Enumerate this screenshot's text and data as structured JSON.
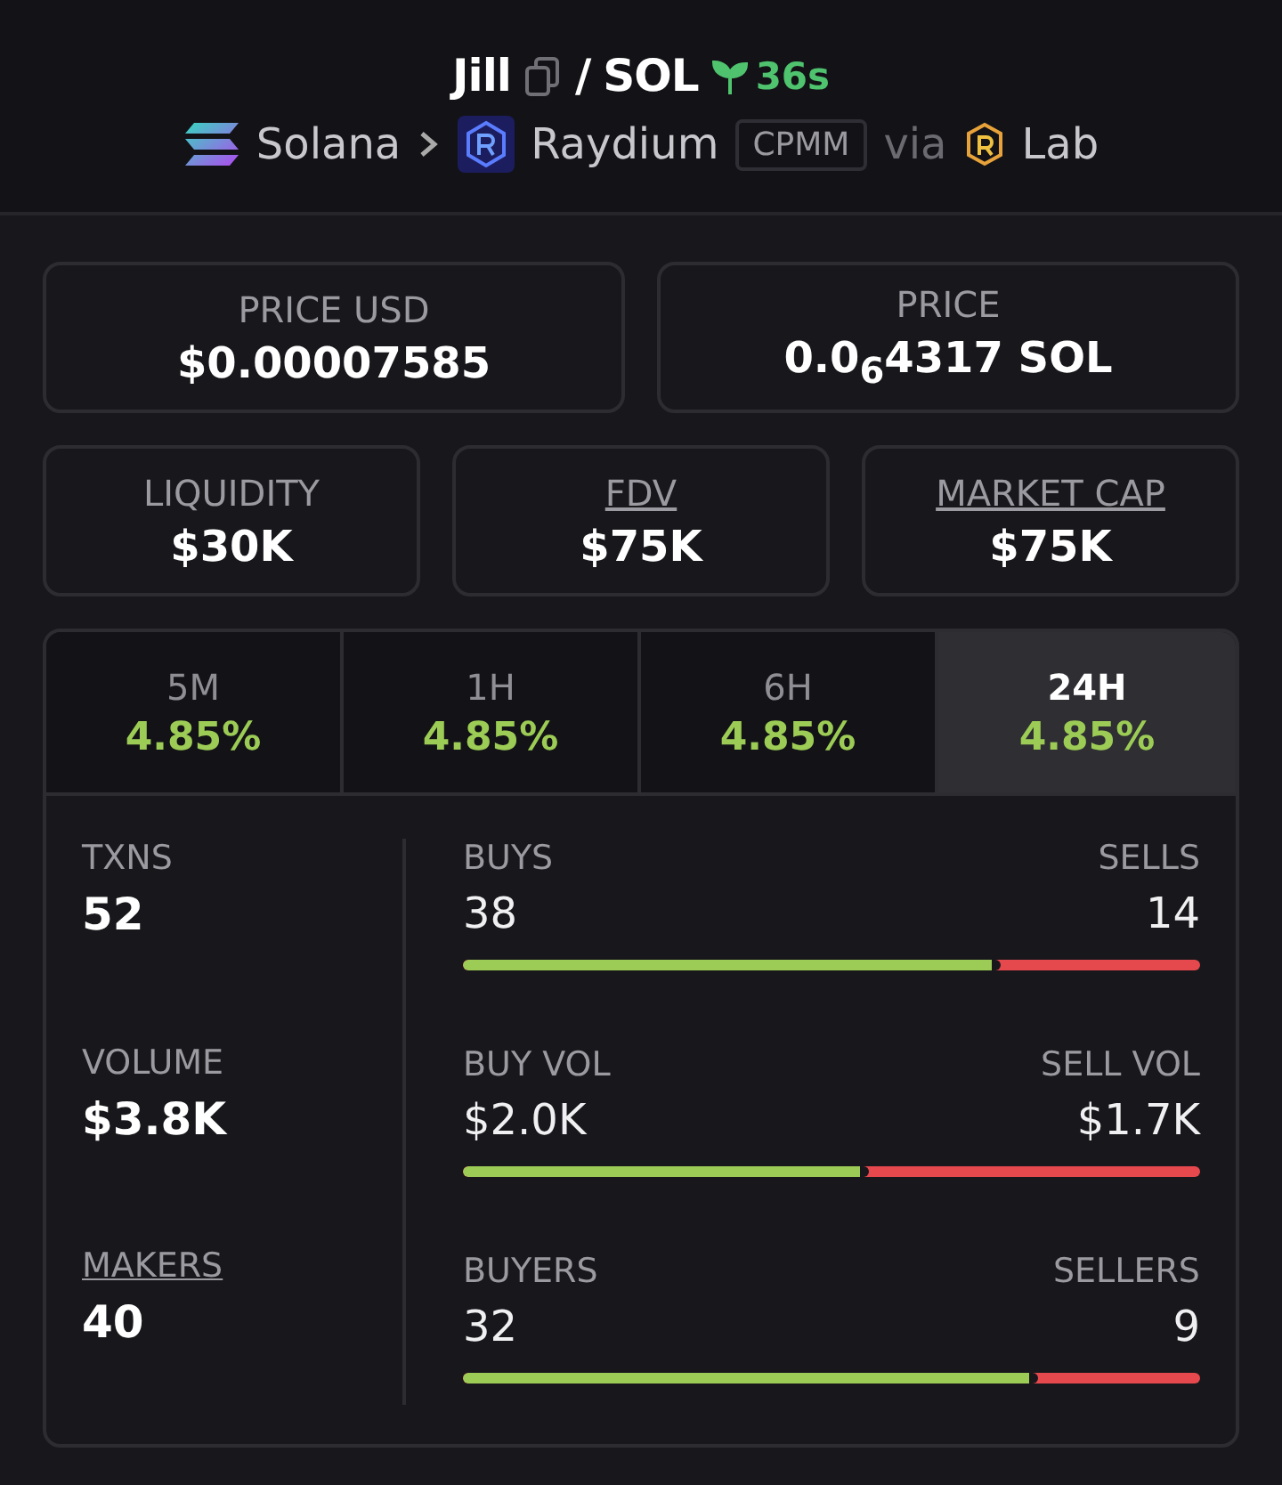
{
  "header": {
    "token": "Jill",
    "separator": "/",
    "quote": "SOL",
    "age": "36s",
    "chain": "Solana",
    "dex": "Raydium",
    "pool_type": "CPMM",
    "via": "via",
    "via_name": "Lab"
  },
  "price_cards": [
    {
      "label": "PRICE USD",
      "value": "$0.00007585"
    },
    {
      "label": "PRICE",
      "value": "0.0$_{6}$4317 SOL"
    }
  ],
  "stat_cards": [
    {
      "label": "LIQUIDITY",
      "value": "$30K",
      "underlined": false
    },
    {
      "label": "FDV",
      "value": "$75K",
      "underlined": true
    },
    {
      "label": "MARKET CAP",
      "value": "$75K",
      "underlined": true
    }
  ],
  "tabs": [
    {
      "label": "5M",
      "change": "4.85%",
      "selected": false
    },
    {
      "label": "1H",
      "change": "4.85%",
      "selected": false
    },
    {
      "label": "6H",
      "change": "4.85%",
      "selected": false
    },
    {
      "label": "24H",
      "change": "4.85%",
      "selected": true
    }
  ],
  "metrics": [
    {
      "label": "TXNS",
      "value": "52",
      "underlined": false,
      "left_label": "BUYS",
      "left_value": "38",
      "right_label": "SELLS",
      "right_value": "14",
      "level": 0.73
    },
    {
      "label": "VOLUME",
      "value": "$3.8K",
      "underlined": false,
      "left_label": "BUY VOL",
      "left_value": "$2.0K",
      "right_label": "SELL VOL",
      "right_value": "$1.7K",
      "level": 0.55
    },
    {
      "label": "MAKERS",
      "value": "40",
      "underlined": true,
      "left_label": "BUYERS",
      "left_value": "32",
      "right_label": "SELLERS",
      "right_value": "9",
      "level": 0.78
    }
  ]
}
